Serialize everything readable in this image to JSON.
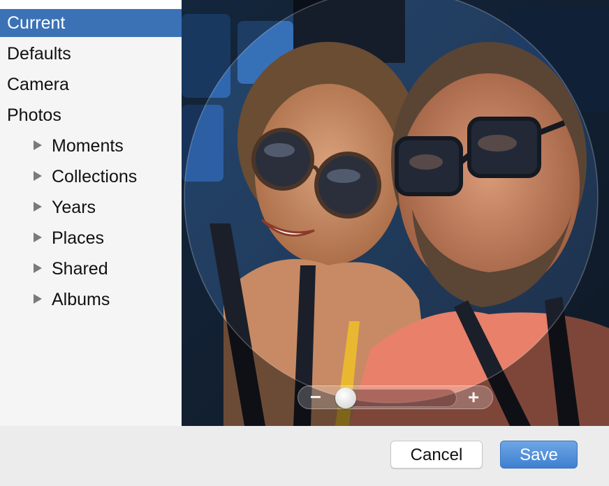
{
  "sidebar": {
    "items": [
      {
        "label": "Current",
        "selected": true
      },
      {
        "label": "Defaults"
      },
      {
        "label": "Camera"
      },
      {
        "label": "Photos"
      }
    ],
    "photo_subitems": [
      {
        "label": "Moments",
        "icon": "disclosure-triangle-icon"
      },
      {
        "label": "Collections",
        "icon": "disclosure-triangle-icon"
      },
      {
        "label": "Years",
        "icon": "disclosure-triangle-icon"
      },
      {
        "label": "Places",
        "icon": "disclosure-triangle-icon"
      },
      {
        "label": "Shared",
        "icon": "disclosure-triangle-icon"
      },
      {
        "label": "Albums",
        "icon": "disclosure-triangle-icon"
      }
    ]
  },
  "editor": {
    "zoom_minus_label": "−",
    "zoom_plus_label": "+",
    "zoom_level": 0.0
  },
  "buttons": {
    "cancel_label": "Cancel",
    "save_label": "Save"
  },
  "colors": {
    "selection": "#3b72b6",
    "save_button": "#4a8ad8"
  }
}
